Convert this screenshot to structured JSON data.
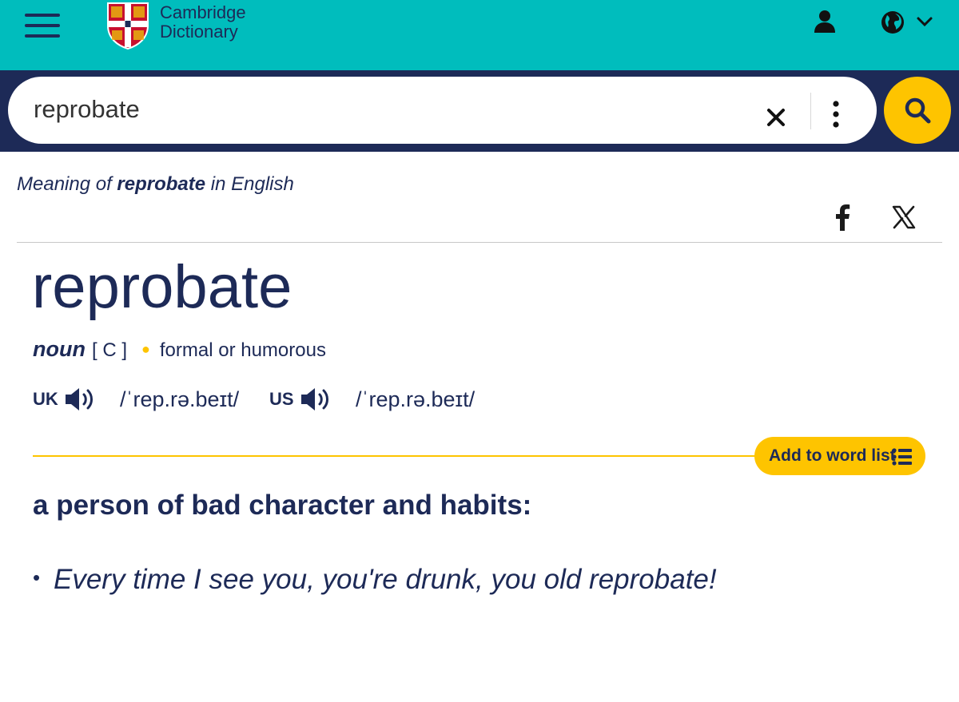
{
  "header": {
    "brand_line1": "Cambridge",
    "brand_line2": "Dictionary",
    "background": "#00bdbd"
  },
  "search": {
    "value": "reprobate",
    "button_color": "#fec400"
  },
  "meaning_header": {
    "prefix": "Meaning of",
    "word": "reprobate",
    "suffix": "in English"
  },
  "entry": {
    "headword": "reprobate",
    "pos": "noun",
    "grammar": "[ C ]",
    "usage": "formal or humorous",
    "pronunciations": [
      {
        "region": "UK",
        "ipa": "/ˈrep.rə.beɪt/"
      },
      {
        "region": "US",
        "ipa": "/ˈrep.rə.beɪt/"
      }
    ],
    "add_to_list_label": "Add to word list",
    "definition": "a person of bad character and habits:",
    "examples": [
      "Every time I see you, you're drunk, you old reprobate!"
    ]
  },
  "colors": {
    "navy": "#1d2a57",
    "teal": "#00bdbd",
    "yellow": "#fec400"
  },
  "icons": [
    "menu-icon",
    "crest-logo",
    "user-icon",
    "globe-icon",
    "chevron-down-icon",
    "clear-icon",
    "more-vertical-icon",
    "search-icon",
    "facebook-icon",
    "x-twitter-icon",
    "speaker-icon",
    "list-icon"
  ]
}
